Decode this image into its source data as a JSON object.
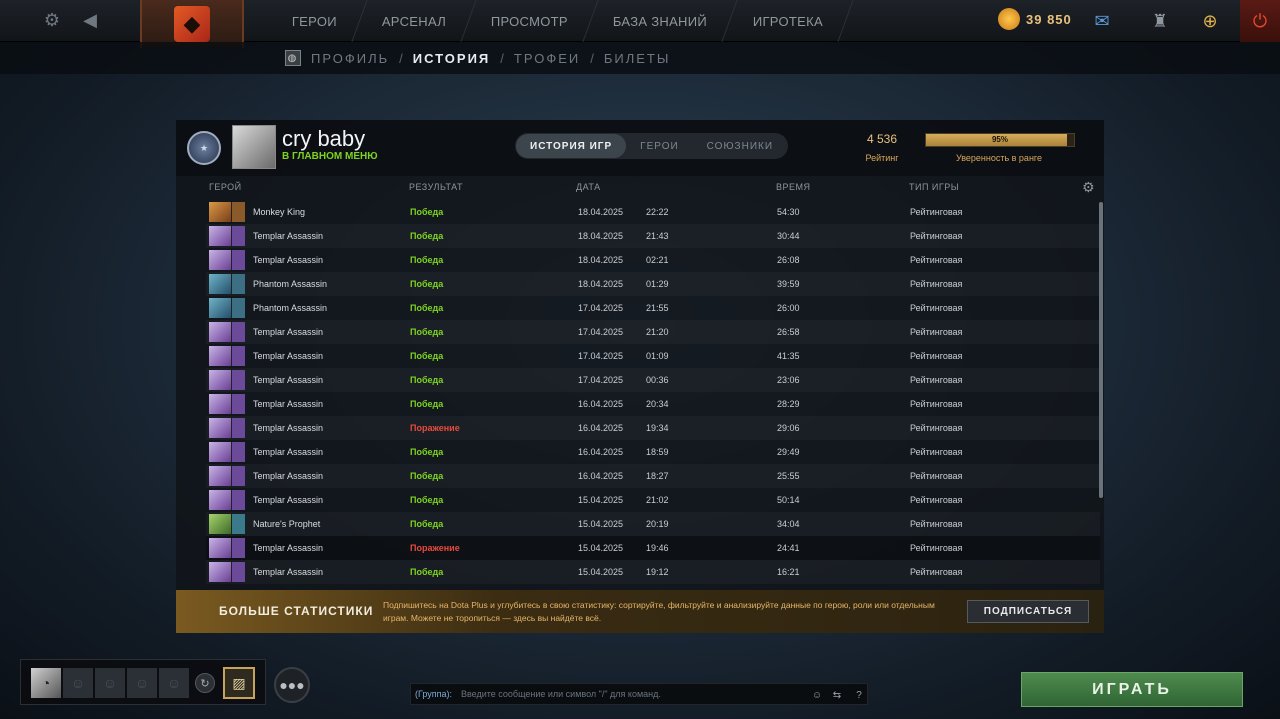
{
  "topbar": {
    "nav": [
      "ГЕРОИ",
      "АРСЕНАЛ",
      "ПРОСМОТР",
      "БАЗА ЗНАНИЙ",
      "ИГРОТЕКА"
    ],
    "currency": "39 850",
    "icons": [
      "gear-icon",
      "back-arrow-icon",
      "dota-logo-icon",
      "chat-bubble-icon",
      "armory-icon",
      "plus-icon",
      "power-icon"
    ]
  },
  "subnav": {
    "items": [
      "ПРОФИЛЬ",
      "ИСТОРИЯ",
      "ТРОФЕИ",
      "БИЛЕТЫ"
    ],
    "separator": "/"
  },
  "profile": {
    "name": "cry baby",
    "status": "В ГЛАВНОМ МЕНЮ",
    "rating_value": "4 536",
    "rating_label": "Рейтинг",
    "confidence_text": "95%",
    "confidence_fraction": 0.95,
    "confidence_label": "Уверенность в ранге",
    "tabs": [
      "ИСТОРИЯ ИГР",
      "ГЕРОИ",
      "СОЮЗНИКИ"
    ]
  },
  "table": {
    "headers": [
      "ГЕРОЙ",
      "РЕЗУЛЬТАТ",
      "ДАТА",
      "ВРЕМЯ",
      "ТИП ИГРЫ"
    ],
    "rows": [
      {
        "hero": "Monkey King",
        "result": "Победа",
        "date": "18.04.2025",
        "time": "22:22",
        "duration": "54:30",
        "type": "Рейтинговая"
      },
      {
        "hero": "Templar Assassin",
        "result": "Победа",
        "date": "18.04.2025",
        "time": "21:43",
        "duration": "30:44",
        "type": "Рейтинговая"
      },
      {
        "hero": "Templar Assassin",
        "result": "Победа",
        "date": "18.04.2025",
        "time": "02:21",
        "duration": "26:08",
        "type": "Рейтинговая"
      },
      {
        "hero": "Phantom Assassin",
        "result": "Победа",
        "date": "18.04.2025",
        "time": "01:29",
        "duration": "39:59",
        "type": "Рейтинговая"
      },
      {
        "hero": "Phantom Assassin",
        "result": "Победа",
        "date": "17.04.2025",
        "time": "21:55",
        "duration": "26:00",
        "type": "Рейтинговая"
      },
      {
        "hero": "Templar Assassin",
        "result": "Победа",
        "date": "17.04.2025",
        "time": "21:20",
        "duration": "26:58",
        "type": "Рейтинговая"
      },
      {
        "hero": "Templar Assassin",
        "result": "Победа",
        "date": "17.04.2025",
        "time": "01:09",
        "duration": "41:35",
        "type": "Рейтинговая"
      },
      {
        "hero": "Templar Assassin",
        "result": "Победа",
        "date": "17.04.2025",
        "time": "00:36",
        "duration": "23:06",
        "type": "Рейтинговая"
      },
      {
        "hero": "Templar Assassin",
        "result": "Победа",
        "date": "16.04.2025",
        "time": "20:34",
        "duration": "28:29",
        "type": "Рейтинговая"
      },
      {
        "hero": "Templar Assassin",
        "result": "Поражение",
        "date": "16.04.2025",
        "time": "19:34",
        "duration": "29:06",
        "type": "Рейтинговая"
      },
      {
        "hero": "Templar Assassin",
        "result": "Победа",
        "date": "16.04.2025",
        "time": "18:59",
        "duration": "29:49",
        "type": "Рейтинговая"
      },
      {
        "hero": "Templar Assassin",
        "result": "Победа",
        "date": "16.04.2025",
        "time": "18:27",
        "duration": "25:55",
        "type": "Рейтинговая"
      },
      {
        "hero": "Templar Assassin",
        "result": "Победа",
        "date": "15.04.2025",
        "time": "21:02",
        "duration": "50:14",
        "type": "Рейтинговая"
      },
      {
        "hero": "Nature's Prophet",
        "result": "Победа",
        "date": "15.04.2025",
        "time": "20:19",
        "duration": "34:04",
        "type": "Рейтинговая"
      },
      {
        "hero": "Templar Assassin",
        "result": "Поражение",
        "date": "15.04.2025",
        "time": "19:46",
        "duration": "24:41",
        "type": "Рейтинговая"
      },
      {
        "hero": "Templar Assassin",
        "result": "Победа",
        "date": "15.04.2025",
        "time": "19:12",
        "duration": "16:21",
        "type": "Рейтинговая"
      }
    ]
  },
  "promo": {
    "title": "БОЛЬШЕ СТАТИСТИКИ",
    "text": "Подпишитесь на Dota Plus и углубитесь в свою статистику: сортируйте, фильтруйте и анализируйте данные по герою, роли или отдельным играм. Можете не торопиться — здесь вы найдёте всё.",
    "button": "ПОДПИСАТЬСЯ"
  },
  "chat": {
    "channel": "(Группа):",
    "placeholder": "Введите сообщение или символ \"/\" для команд."
  },
  "play_button": "ИГРАТЬ",
  "colors": {
    "win": "#7ed321",
    "loss": "#e84a3c",
    "gold": "#e8c27a",
    "play": "#3f7a40"
  }
}
